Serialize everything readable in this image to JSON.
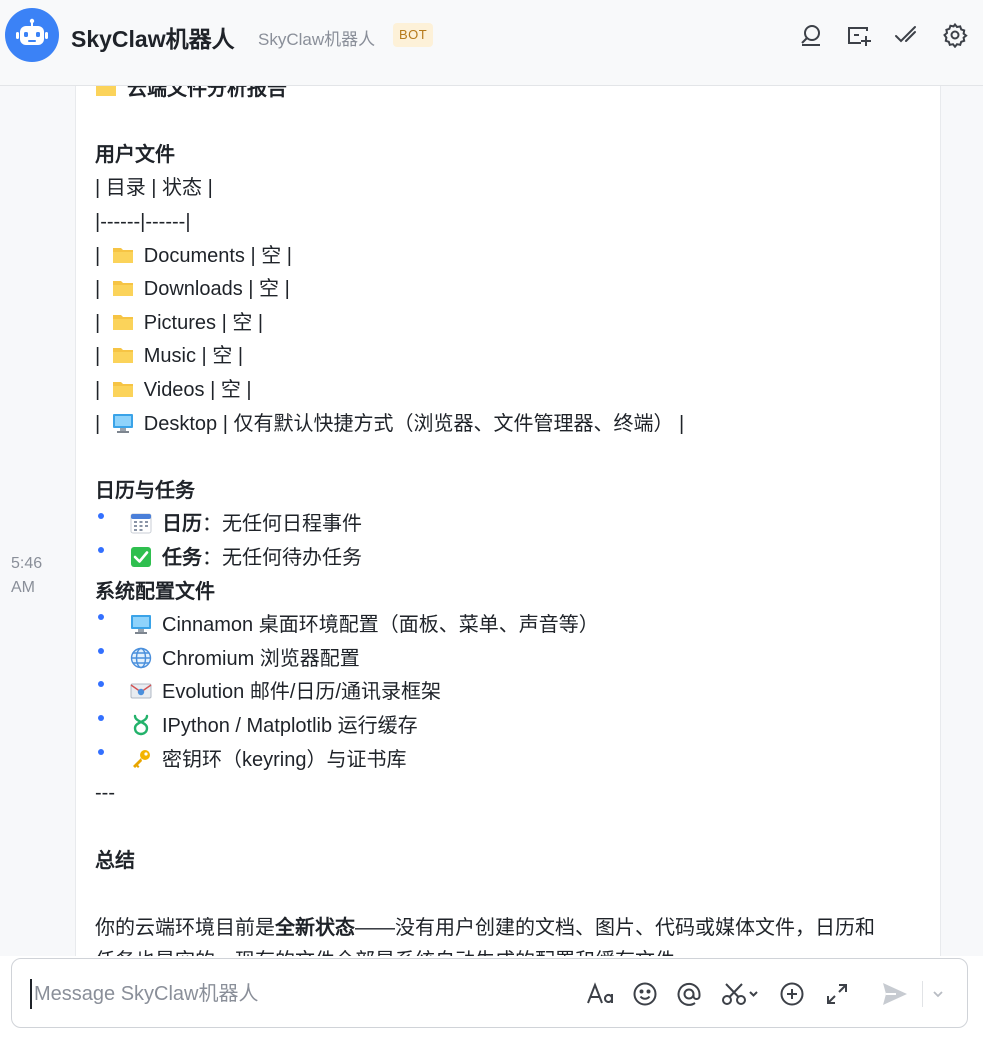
{
  "header": {
    "title": "SkyClaw机器人",
    "subtitle": "SkyClaw机器人",
    "badge": "BOT",
    "icons": [
      "search-icon",
      "new-topic-icon",
      "checkmark-icon",
      "settings-icon"
    ]
  },
  "message": {
    "time": "5:46 AM",
    "report_heading": "云端文件分析报告",
    "user_files": {
      "heading": "用户文件",
      "table_header": "| 目录 | 状态 |",
      "table_sep": "|------|------|",
      "rows": [
        {
          "icon": "folder-icon",
          "name": "Documents",
          "status": "空"
        },
        {
          "icon": "folder-icon",
          "name": "Downloads",
          "status": "空"
        },
        {
          "icon": "folder-icon",
          "name": "Pictures",
          "status": "空"
        },
        {
          "icon": "folder-icon",
          "name": "Music",
          "status": "空"
        },
        {
          "icon": "folder-icon",
          "name": "Videos",
          "status": "空"
        },
        {
          "icon": "monitor-icon",
          "name": "Desktop",
          "status": "仅有默认快捷方式（浏览器、文件管理器、终端）"
        }
      ]
    },
    "calendar_tasks": {
      "heading": "日历与任务",
      "items": [
        {
          "icon": "calendar-icon",
          "label": "日历",
          "text": "：无任何日程事件"
        },
        {
          "icon": "check-box-icon",
          "label": "任务",
          "text": "：无任何待办任务"
        }
      ]
    },
    "config_files": {
      "heading": "系统配置文件",
      "items": [
        {
          "icon": "monitor-icon",
          "text": "Cinnamon 桌面环境配置（面板、菜单、声音等）"
        },
        {
          "icon": "globe-icon",
          "text": "Chromium 浏览器配置"
        },
        {
          "icon": "envelope-icon",
          "text": "Evolution 邮件/日历/通讯录框架"
        },
        {
          "icon": "dna-icon",
          "text": "IPython / Matplotlib 运行缓存"
        },
        {
          "icon": "key-icon",
          "text": "密钥环（keyring）与证书库"
        }
      ]
    },
    "divider": "---",
    "summary": {
      "heading": "总结",
      "line1_pre": "你的云端环境目前是",
      "line1_bold": "全新状态",
      "line1_post": "——没有用户创建的文档、图片、代码或媒体文件，日历和",
      "line2": "任务也是空的，现有的文件全部是系统自动生成的配置和缓存文件。"
    }
  },
  "composer": {
    "placeholder": "Message SkyClaw机器人",
    "value": "",
    "tools": [
      "text-format-icon",
      "emoji-icon",
      "mention-icon",
      "scissors-icon",
      "plus-circle-icon",
      "expand-icon",
      "send-icon",
      "chevron-down-icon"
    ]
  }
}
